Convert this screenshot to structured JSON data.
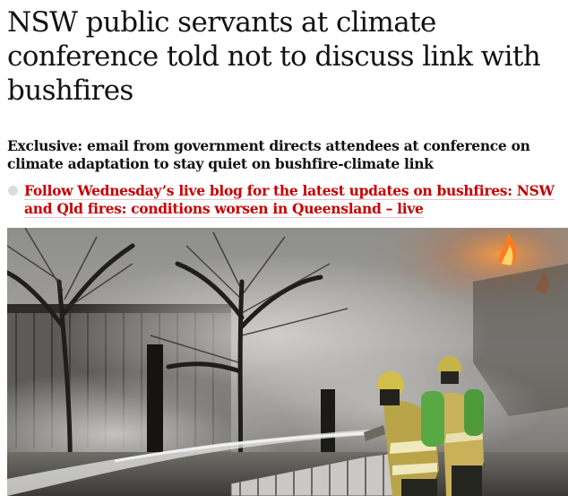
{
  "article": {
    "headline": "NSW public servants at climate conference told not to discuss link with bushfires",
    "standfirst": "Exclusive: email from government directs attendees at conference on climate adaptation to stay quiet on bushfire-climate link",
    "live_links": [
      {
        "label": "Follow Wednesday’s live blog for the latest updates on bushfires: NSW and Qld fires: conditions worsen in Queensland – live"
      }
    ],
    "link_color": "#c70000",
    "bullet_color": "#dcdcdc",
    "hero_image": {
      "icon": "photo-firefighters-hosing-bushfire"
    }
  }
}
